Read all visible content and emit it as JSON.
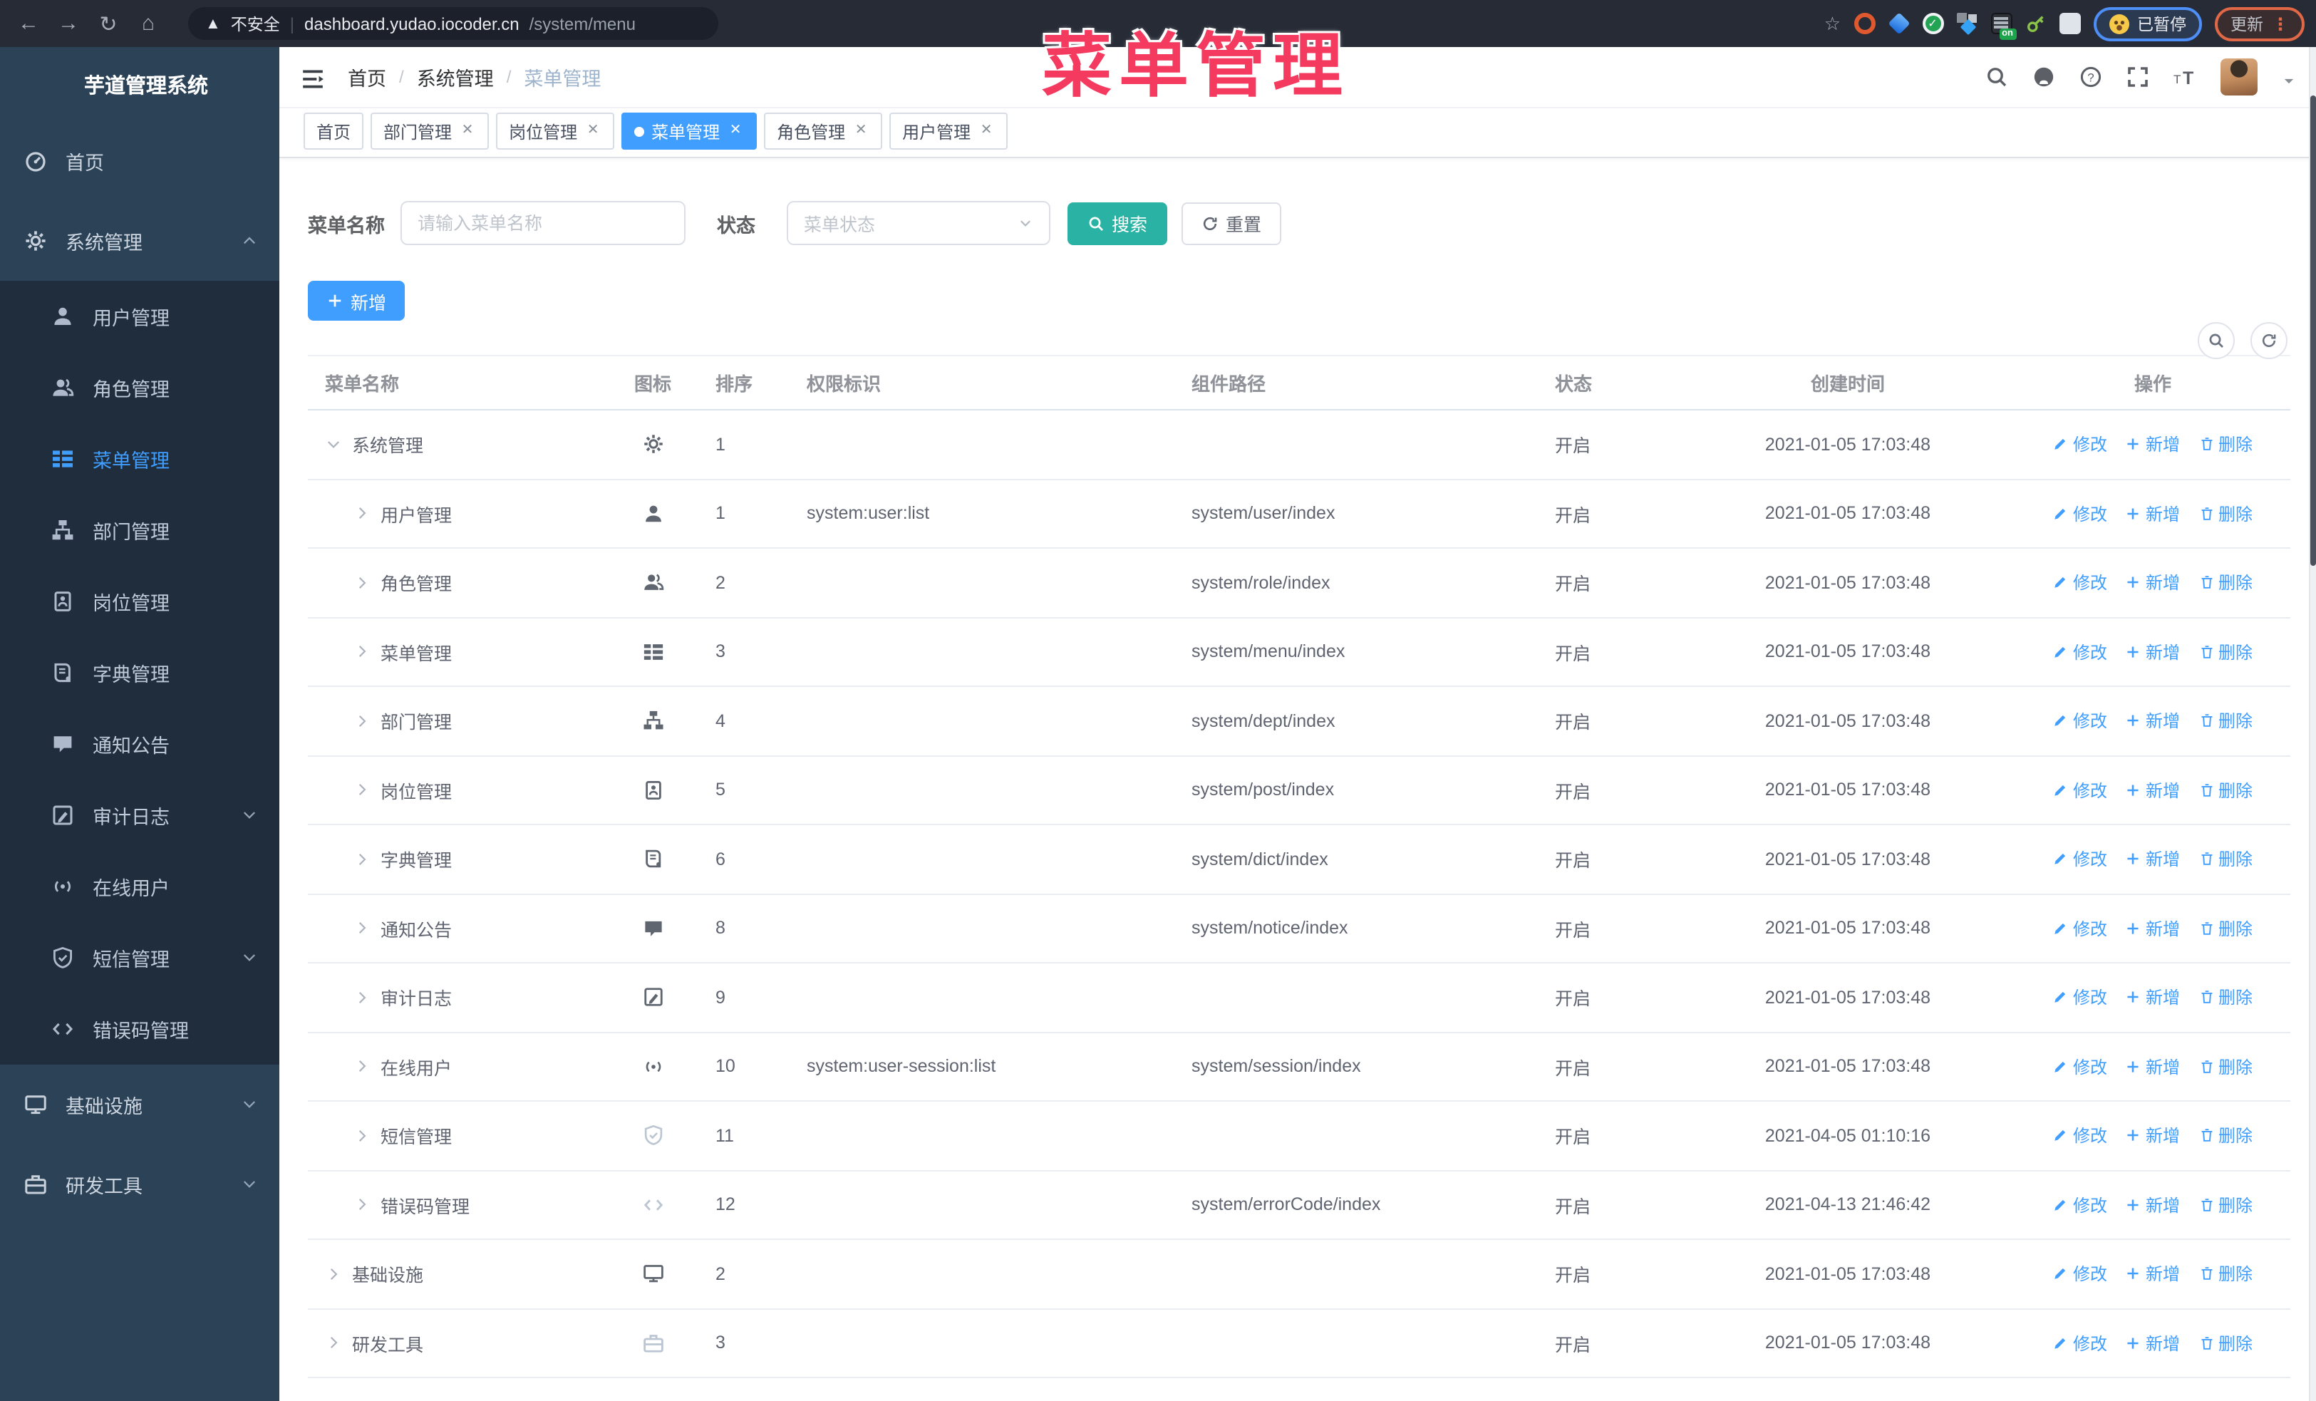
{
  "browser": {
    "security_label": "不安全",
    "url_host": "dashboard.yudao.iocoder.cn",
    "url_path": "/system/menu",
    "url_separator": "|",
    "pause_badge": "已暂停",
    "update_button": "更新"
  },
  "annotation": {
    "text": "菜单管理"
  },
  "sidebar": {
    "title": "芋道管理系统",
    "items": [
      {
        "label": "首页",
        "icon": "dashboard",
        "level": 0
      },
      {
        "label": "系统管理",
        "icon": "gear",
        "level": 0,
        "chevron": "up"
      },
      {
        "label": "用户管理",
        "icon": "user",
        "level": 1
      },
      {
        "label": "角色管理",
        "icon": "users",
        "level": 1
      },
      {
        "label": "菜单管理",
        "icon": "menu",
        "level": 1,
        "active": true
      },
      {
        "label": "部门管理",
        "icon": "tree",
        "level": 1
      },
      {
        "label": "岗位管理",
        "icon": "post",
        "level": 1
      },
      {
        "label": "字典管理",
        "icon": "dict",
        "level": 1
      },
      {
        "label": "通知公告",
        "icon": "message",
        "level": 1
      },
      {
        "label": "审计日志",
        "icon": "log",
        "level": 1,
        "chevron": "down"
      },
      {
        "label": "在线用户",
        "icon": "online",
        "level": 1
      },
      {
        "label": "短信管理",
        "icon": "sms",
        "level": 1,
        "chevron": "down"
      },
      {
        "label": "错误码管理",
        "icon": "code",
        "level": 1
      },
      {
        "label": "基础设施",
        "icon": "monitor",
        "level": 0,
        "chevron": "down"
      },
      {
        "label": "研发工具",
        "icon": "tool",
        "level": 0,
        "chevron": "down"
      }
    ]
  },
  "header": {
    "breadcrumb": [
      "首页",
      "系统管理",
      "菜单管理"
    ]
  },
  "tabs": [
    {
      "label": "首页",
      "closable": false,
      "active": false
    },
    {
      "label": "部门管理",
      "closable": true,
      "active": false
    },
    {
      "label": "岗位管理",
      "closable": true,
      "active": false
    },
    {
      "label": "菜单管理",
      "closable": true,
      "active": true
    },
    {
      "label": "角色管理",
      "closable": true,
      "active": false
    },
    {
      "label": "用户管理",
      "closable": true,
      "active": false
    }
  ],
  "filters": {
    "name_label": "菜单名称",
    "name_placeholder": "请输入菜单名称",
    "status_label": "状态",
    "status_placeholder": "菜单状态",
    "search_label": "搜索",
    "reset_label": "重置"
  },
  "toolbar": {
    "add_label": "新增"
  },
  "table": {
    "columns": [
      "菜单名称",
      "图标",
      "排序",
      "权限标识",
      "组件路径",
      "状态",
      "创建时间",
      "操作"
    ],
    "actions": {
      "edit": "修改",
      "add": "新增",
      "delete": "删除"
    },
    "rows": [
      {
        "name": "系统管理",
        "indent": 0,
        "caret": "expanded",
        "icon": "gear",
        "order": "1",
        "perm": "",
        "path": "",
        "status": "开启",
        "time": "2021-01-05 17:03:48"
      },
      {
        "name": "用户管理",
        "indent": 1,
        "caret": "collapsed",
        "icon": "user",
        "order": "1",
        "perm": "system:user:list",
        "path": "system/user/index",
        "status": "开启",
        "time": "2021-01-05 17:03:48"
      },
      {
        "name": "角色管理",
        "indent": 1,
        "caret": "collapsed",
        "icon": "users",
        "order": "2",
        "perm": "",
        "path": "system/role/index",
        "status": "开启",
        "time": "2021-01-05 17:03:48"
      },
      {
        "name": "菜单管理",
        "indent": 1,
        "caret": "collapsed",
        "icon": "menu",
        "order": "3",
        "perm": "",
        "path": "system/menu/index",
        "status": "开启",
        "time": "2021-01-05 17:03:48"
      },
      {
        "name": "部门管理",
        "indent": 1,
        "caret": "collapsed",
        "icon": "tree",
        "order": "4",
        "perm": "",
        "path": "system/dept/index",
        "status": "开启",
        "time": "2021-01-05 17:03:48"
      },
      {
        "name": "岗位管理",
        "indent": 1,
        "caret": "collapsed",
        "icon": "post",
        "order": "5",
        "perm": "",
        "path": "system/post/index",
        "status": "开启",
        "time": "2021-01-05 17:03:48"
      },
      {
        "name": "字典管理",
        "indent": 1,
        "caret": "collapsed",
        "icon": "dict",
        "order": "6",
        "perm": "",
        "path": "system/dict/index",
        "status": "开启",
        "time": "2021-01-05 17:03:48"
      },
      {
        "name": "通知公告",
        "indent": 1,
        "caret": "collapsed",
        "icon": "message",
        "order": "8",
        "perm": "",
        "path": "system/notice/index",
        "status": "开启",
        "time": "2021-01-05 17:03:48"
      },
      {
        "name": "审计日志",
        "indent": 1,
        "caret": "collapsed",
        "icon": "log",
        "order": "9",
        "perm": "",
        "path": "",
        "status": "开启",
        "time": "2021-01-05 17:03:48"
      },
      {
        "name": "在线用户",
        "indent": 1,
        "caret": "collapsed",
        "icon": "online",
        "order": "10",
        "perm": "system:user-session:list",
        "path": "system/session/index",
        "status": "开启",
        "time": "2021-01-05 17:03:48"
      },
      {
        "name": "短信管理",
        "indent": 1,
        "caret": "collapsed",
        "icon": "sms",
        "icon_muted": true,
        "order": "11",
        "perm": "",
        "path": "",
        "status": "开启",
        "time": "2021-04-05 01:10:16"
      },
      {
        "name": "错误码管理",
        "indent": 1,
        "caret": "collapsed",
        "icon": "code",
        "icon_muted": true,
        "order": "12",
        "perm": "",
        "path": "system/errorCode/index",
        "status": "开启",
        "time": "2021-04-13 21:46:42"
      },
      {
        "name": "基础设施",
        "indent": 0,
        "caret": "collapsed",
        "icon": "monitor",
        "order": "2",
        "perm": "",
        "path": "",
        "status": "开启",
        "time": "2021-01-05 17:03:48"
      },
      {
        "name": "研发工具",
        "indent": 0,
        "caret": "collapsed",
        "icon": "tool",
        "icon_muted": true,
        "order": "3",
        "perm": "",
        "path": "",
        "status": "开启",
        "time": "2021-01-05 17:03:48"
      }
    ]
  },
  "colors": {
    "accent": "#409eff",
    "search_button": "#2ab3a4",
    "annotation": "#f43a5f"
  }
}
